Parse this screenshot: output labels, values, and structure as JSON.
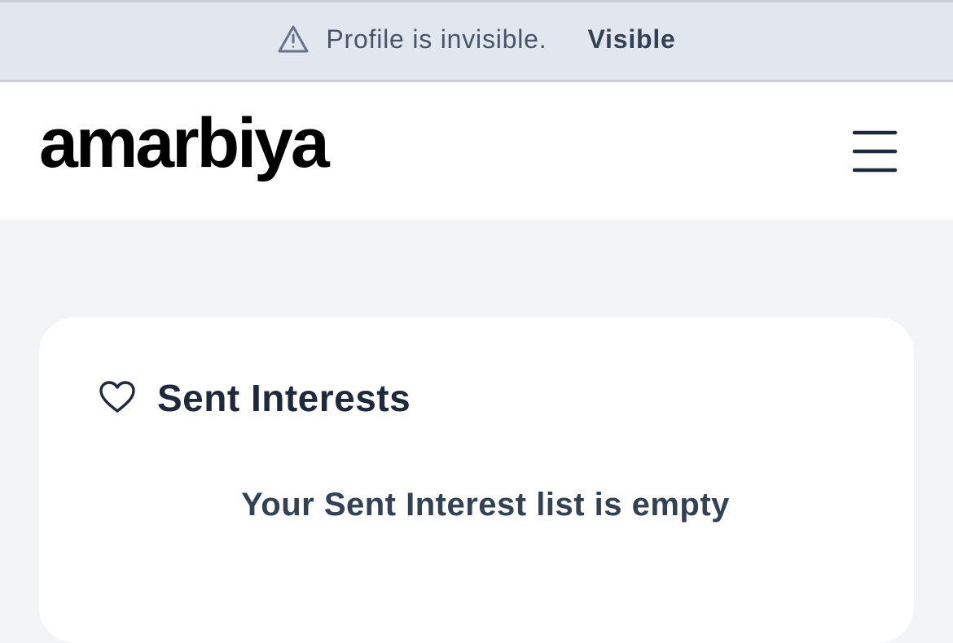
{
  "banner": {
    "icon": "warning-triangle-icon",
    "message": "Profile is invisible.",
    "action_label": "Visible"
  },
  "header": {
    "logo_text": "amarbiya",
    "menu_icon": "hamburger-menu-icon"
  },
  "card": {
    "icon": "heart-icon",
    "title": "Sent Interests",
    "empty_message": "Your Sent Interest list is empty"
  },
  "colors": {
    "banner_bg": "#e2e7ef",
    "page_bg": "#f3f4f6",
    "text_dark": "#1e293b",
    "text_muted": "#475569"
  }
}
